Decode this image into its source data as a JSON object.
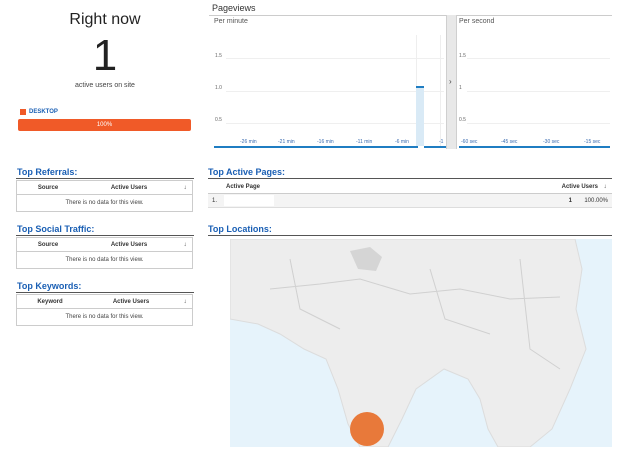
{
  "right_now": {
    "title": "Right now",
    "count": "1",
    "subtitle": "active users on site",
    "device_label": "DESKTOP",
    "device_percent_label": "100%",
    "device_share": 1.0
  },
  "pageviews": {
    "title": "Pageviews",
    "per_minute": {
      "label": "Per minute",
      "y_ticks": [
        "1.5",
        "1.0",
        "0.5"
      ],
      "x_ticks": [
        "-26 min",
        "-21 min",
        "-16 min",
        "-11 min",
        "-6 min",
        "-1"
      ],
      "bar_value": 1
    },
    "per_second": {
      "label": "Per second",
      "y_ticks": [
        "1.5",
        "1",
        "0.5"
      ],
      "x_ticks": [
        "-60 sec",
        "-45 sec",
        "-30 sec",
        "-15 sec"
      ]
    },
    "expand_arrow": "›"
  },
  "top_referrals": {
    "title": "Top Referrals:",
    "col_source": "Source",
    "col_users": "Active Users",
    "sort_icon": "↓",
    "empty": "There is no data for this view."
  },
  "top_social": {
    "title": "Top Social Traffic:",
    "col_source": "Source",
    "col_users": "Active Users",
    "sort_icon": "↓",
    "empty": "There is no data for this view."
  },
  "top_keywords": {
    "title": "Top Keywords:",
    "col_keyword": "Keyword",
    "col_users": "Active Users",
    "sort_icon": "↓",
    "empty": "There is no data for this view."
  },
  "top_active_pages": {
    "title": "Top Active Pages:",
    "col_page": "Active Page",
    "col_users": "Active Users",
    "sort_icon": "↓",
    "rows": [
      {
        "index": "1.",
        "page": "",
        "users": "1",
        "percent": "100.00%"
      }
    ]
  },
  "top_locations": {
    "title": "Top Locations:"
  },
  "colors": {
    "accent_blue": "#1a5fb4",
    "device_orange": "#f05a28",
    "location_marker": "#e8793a"
  }
}
